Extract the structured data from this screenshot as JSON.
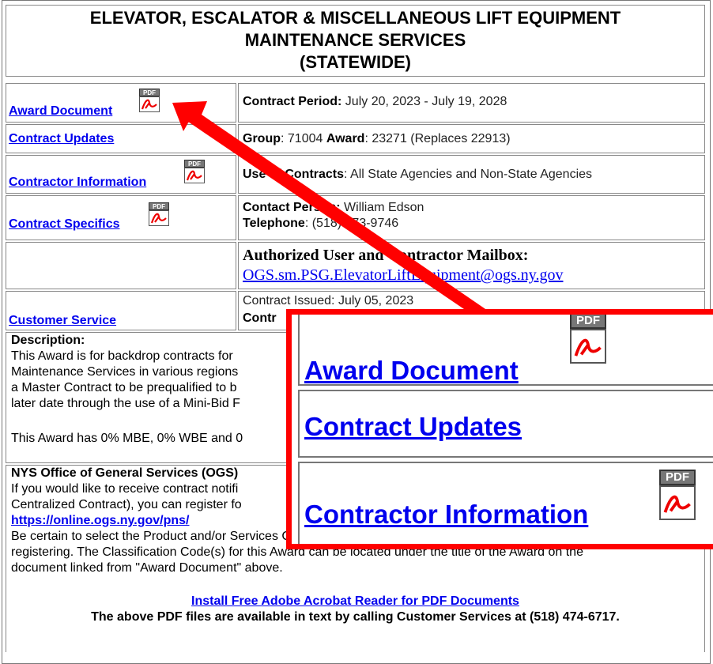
{
  "header": {
    "line1": "ELEVATOR, ESCALATOR & MISCELLANEOUS LIFT EQUIPMENT",
    "line2": "MAINTENANCE SERVICES",
    "line3": "(STATEWIDE)"
  },
  "links": {
    "award_document": "Award Document",
    "contract_updates": "Contract Updates",
    "contractor_information": "Contractor Information",
    "contract_specifics": "Contract Specifics",
    "customer_service": "Customer Service"
  },
  "pdf_badge": "PDF",
  "info": {
    "contract_period_label": "Contract Period:",
    "contract_period_value": "July 20, 2023 - July 19, 2028",
    "group_label": "Group",
    "group_value": ": 71004",
    "award_label": "Award",
    "award_value": ": 23271 (Replaces 22913)",
    "use_label": "Use of Contracts",
    "use_value": ": All State Agencies and Non-State Agencies",
    "contact_label": "Contact Person:",
    "contact_value": "William Edson",
    "telephone_label": "Telephone",
    "telephone_value": ": (518) 473-9746",
    "mailbox_label": "Authorized User and Contractor Mailbox:",
    "mailbox_email": "OGS.sm.PSG.ElevatorLiftEquipment@ogs.ny.gov",
    "issued_label": "Contract Issued:",
    "issued_value": "July 05, 2023",
    "contr_partial": "Contr"
  },
  "description": {
    "heading": "Description:",
    "line1": "This Award is for backdrop contracts for",
    "line2": "Maintenance Services in various regions",
    "line3": "a Master Contract to be prequalified to b",
    "line4": "later date through the use of a Mini-Bid F",
    "mbe_line": "This Award has 0% MBE, 0% WBE and 0"
  },
  "ogs": {
    "heading": "NYS Office of General Services (OGS)",
    "line1": "If you would like to receive contract notifi",
    "line2": "Centralized Contract), you can register fo",
    "link": "https://online.ogs.ny.gov/pns/",
    "line3": "Be certain to select the Product and/or Services Classification Codes that fit your interests when",
    "line4": "registering. The Classification Code(s) for this Award can be located under the title of the Award on the",
    "line5": "document linked from \"Award Document\" above."
  },
  "footer": {
    "acrobat_link": "Install Free Adobe Acrobat Reader for PDF Documents",
    "note": "The above PDF files are available in text by calling Customer Services at (518) 474-6717."
  },
  "colors": {
    "link": "#0000ee",
    "annotation": "#ff0000"
  }
}
